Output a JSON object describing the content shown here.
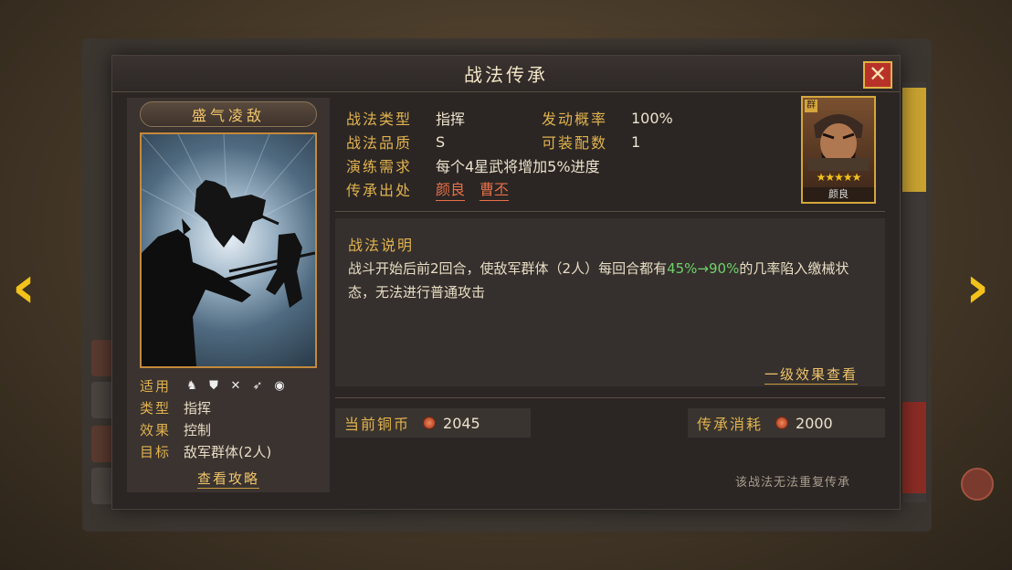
{
  "dialog": {
    "title": "战法传承",
    "close_icon": "close-icon"
  },
  "skill": {
    "name": "盛气凌敌",
    "meta": {
      "applicable_label": "适用",
      "type_label": "类型",
      "type_value": "指挥",
      "effect_label": "效果",
      "effect_value": "控制",
      "target_label": "目标",
      "target_value": "敌军群体(2人)"
    },
    "unit_icons": [
      "cavalry-icon",
      "shield-icon",
      "archer-icon",
      "spear-icon",
      "siege-icon"
    ],
    "guide_link": "查看攻略"
  },
  "info": {
    "type_label": "战法类型",
    "type_value": "指挥",
    "trigger_label": "发动概率",
    "trigger_value": "100%",
    "quality_label": "战法品质",
    "quality_value": "S",
    "equip_label": "可装配数",
    "equip_value": "1",
    "train_label": "演练需求",
    "train_value": "每个4星武将增加5%进度",
    "source_label": "传承出处",
    "sources": [
      "颜良",
      "曹丕"
    ]
  },
  "hero": {
    "name": "颜良",
    "stars": "★★★★★",
    "tag": "群"
  },
  "description": {
    "title": "战法说明",
    "text_part1": "战斗开始后前2回合，使敌军群体（2人）每回合都有",
    "text_highlight": "45%→90%",
    "text_part2": "的几率陷入缴械状态，无法进行普通攻击",
    "level_link": "一级效果查看"
  },
  "currency": {
    "current_label": "当前铜币",
    "current_value": "2045",
    "cost_label": "传承消耗",
    "cost_value": "2000"
  },
  "footer": {
    "note": "该战法无法重复传承"
  },
  "colors": {
    "accent_gold": "#e0b24e",
    "close_red": "#b8322a",
    "highlight_green": "#6fd16a",
    "source_orange": "#e8704a"
  }
}
